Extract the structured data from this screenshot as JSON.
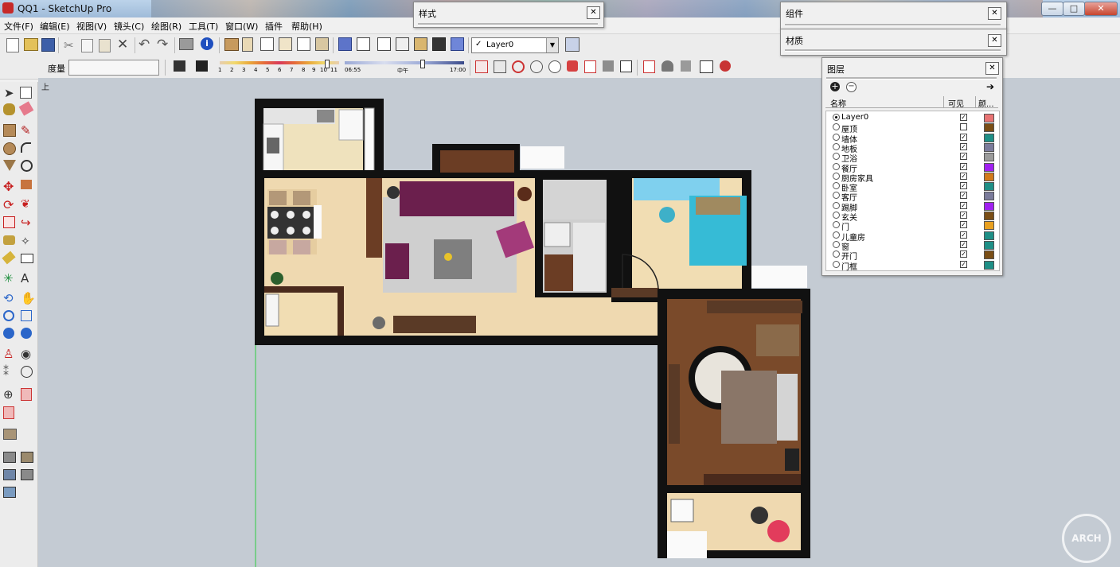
{
  "window": {
    "title": "QQ1 - SketchUp Pro",
    "min": "—",
    "max": "□",
    "close": "✕"
  },
  "menu": [
    "文件(F)",
    "编辑(E)",
    "视图(V)",
    "镜头(C)",
    "绘图(R)",
    "工具(T)",
    "窗口(W)",
    "插件",
    "帮助(H)"
  ],
  "toolbar": {
    "layer_select": "Layer0",
    "measure_label": "度量",
    "measure_value": "",
    "shadow_months": [
      "1",
      "2",
      "3",
      "4",
      "5",
      "6",
      "7",
      "8",
      "9",
      "10",
      "11"
    ],
    "shadow_time_start": "06:55",
    "shadow_time_mid": "中午",
    "shadow_time_end": "17:00"
  },
  "viewport": {
    "view_label": "上"
  },
  "panels": {
    "styles_title": "样式",
    "components_title": "组件",
    "materials_title": "材质",
    "layers_title": "图层",
    "close_glyph": "✕"
  },
  "layers": {
    "col_name": "名称",
    "col_visible": "可见",
    "col_color": "颜...",
    "check_glyph": "✓",
    "add_glyph": "+",
    "remove_glyph": "−",
    "rows": [
      {
        "name": "Layer0",
        "active": true,
        "visible": true,
        "color": "#e87373"
      },
      {
        "name": "屋顶",
        "active": false,
        "visible": false,
        "color": "#7a4e16"
      },
      {
        "name": "墙体",
        "active": false,
        "visible": true,
        "color": "#1f8f86"
      },
      {
        "name": "地板",
        "active": false,
        "visible": true,
        "color": "#7b7b9b"
      },
      {
        "name": "卫浴",
        "active": false,
        "visible": true,
        "color": "#9b9b9b"
      },
      {
        "name": "餐厅",
        "active": false,
        "visible": true,
        "color": "#a020f0"
      },
      {
        "name": "厨房家具",
        "active": false,
        "visible": true,
        "color": "#d27a1a"
      },
      {
        "name": "卧室",
        "active": false,
        "visible": true,
        "color": "#1f8f86"
      },
      {
        "name": "客厅",
        "active": false,
        "visible": true,
        "color": "#7b7b9b"
      },
      {
        "name": "踢脚",
        "active": false,
        "visible": true,
        "color": "#a020f0"
      },
      {
        "name": "玄关",
        "active": false,
        "visible": true,
        "color": "#7a4e16"
      },
      {
        "name": "门",
        "active": false,
        "visible": true,
        "color": "#e8a020"
      },
      {
        "name": "儿童房",
        "active": false,
        "visible": true,
        "color": "#1f8f86"
      },
      {
        "name": "窗",
        "active": false,
        "visible": true,
        "color": "#1f8f86"
      },
      {
        "name": "开门",
        "active": false,
        "visible": true,
        "color": "#7a4e16"
      },
      {
        "name": "门框",
        "active": false,
        "visible": true,
        "color": "#1f8f86"
      }
    ]
  },
  "watermark": "ARCH"
}
